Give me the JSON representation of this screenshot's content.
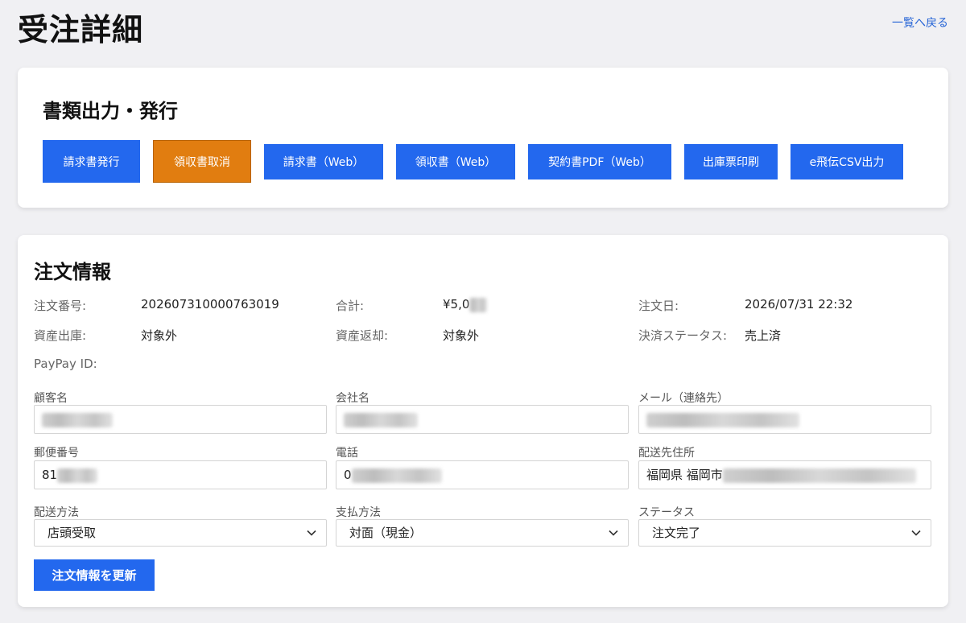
{
  "header": {
    "title": "受注詳細",
    "back_link": "一覧へ戻る"
  },
  "documents": {
    "title": "書類出力・発行",
    "buttons": [
      {
        "label": "請求書発行",
        "color": "#2368ee"
      },
      {
        "label": "領収書取消",
        "color": "#e17d10"
      },
      {
        "label": "請求書（Web）",
        "color": "#2368ee"
      },
      {
        "label": "領収書（Web）",
        "color": "#2368ee"
      },
      {
        "label": "契約書PDF（Web）",
        "color": "#2368ee"
      },
      {
        "label": "出庫票印刷",
        "color": "#2368ee"
      },
      {
        "label": "e飛伝CSV出力",
        "color": "#2368ee"
      }
    ]
  },
  "order": {
    "title": "注文情報",
    "info": {
      "order_number_label": "注文番号:",
      "order_number": "202607310000763019",
      "total_label": "合計:",
      "total": "¥5,0",
      "order_date_label": "注文日:",
      "order_date": "2026/07/31 22:32",
      "asset_out_label": "資産出庫:",
      "asset_out": "対象外",
      "asset_return_label": "資産返却:",
      "asset_return": "対象外",
      "payment_status_label": "決済ステータス:",
      "payment_status": "売上済",
      "paypay_label": "PayPay ID:"
    },
    "fields": {
      "customer_name_label": "顧客名",
      "company_name_label": "会社名",
      "email_label": "メール（連絡先）",
      "postal_code_label": "郵便番号",
      "postal_code_value": "81",
      "phone_label": "電話",
      "phone_value": "0",
      "address_label": "配送先住所",
      "address_value": "福岡県 福岡市",
      "shipping_method_label": "配送方法",
      "shipping_method": "店頭受取",
      "payment_method_label": "支払方法",
      "payment_method": "対面（現金）",
      "status_label": "ステータス",
      "status": "注文完了"
    },
    "update_button": "注文情報を更新"
  }
}
